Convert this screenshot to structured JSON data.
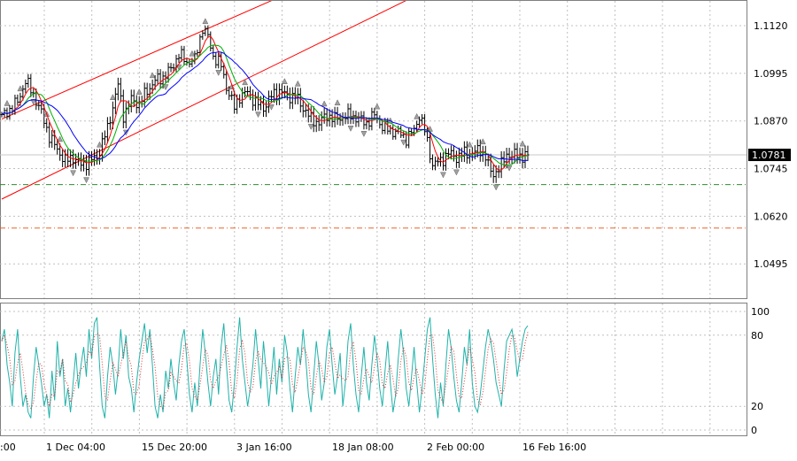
{
  "chart_data": [
    {
      "type": "candlestick",
      "title": "",
      "price_axis_ticks": [
        "1.1120",
        "1.0995",
        "1.0870",
        "1.0745",
        "1.0620",
        "1.0495"
      ],
      "price_axis_values": [
        1.112,
        1.0995,
        1.087,
        1.0745,
        1.062,
        1.0495
      ],
      "ylim": [
        1.0405,
        1.1185
      ],
      "current_price": {
        "label": "1.0781",
        "value": 1.0781,
        "color": "#000000"
      },
      "time_axis_labels": [
        ":00",
        "1 Dec 04:00",
        "15 Dec 20:00",
        "3 Jan 16:00",
        "18 Jan 08:00",
        "2 Feb 00:00",
        "16 Feb 16:00"
      ],
      "horizontal_levels": [
        {
          "value": 1.0703,
          "color": "#2e8b2e",
          "style": "dash-dot"
        },
        {
          "value": 1.0589,
          "color": "#e8622a",
          "style": "dash-dot"
        }
      ],
      "channel": {
        "color": "#ff0000",
        "upper": [
          [
            0,
            1.0875
          ],
          [
            110,
            1.121
          ]
        ],
        "lower": [
          [
            0,
            1.0665
          ],
          [
            160,
            1.121
          ]
        ]
      },
      "bars": 200,
      "close_path": [
        [
          0,
          1.088
        ],
        [
          6,
          1.092
        ],
        [
          9,
          1.0975
        ],
        [
          12,
          1.094
        ],
        [
          15,
          1.089
        ],
        [
          18,
          1.083
        ],
        [
          21,
          1.0795
        ],
        [
          24,
          1.0765
        ],
        [
          27,
          1.0775
        ],
        [
          30,
          1.0755
        ],
        [
          33,
          1.0765
        ],
        [
          36,
          1.0775
        ],
        [
          40,
          1.085
        ],
        [
          44,
          1.0965
        ],
        [
          46,
          1.0885
        ],
        [
          49,
          1.0925
        ],
        [
          52,
          1.0915
        ],
        [
          55,
          1.095
        ],
        [
          58,
          1.0975
        ],
        [
          61,
          1.0985
        ],
        [
          64,
          1.1005
        ],
        [
          67,
          1.1045
        ],
        [
          70,
          1.1025
        ],
        [
          73,
          1.103
        ],
        [
          76,
          1.1115
        ],
        [
          78,
          1.109
        ],
        [
          80,
          1.104
        ],
        [
          83,
          1.1015
        ],
        [
          85,
          1.096
        ],
        [
          88,
          1.0905
        ],
        [
          90,
          1.0935
        ],
        [
          93,
          1.0945
        ],
        [
          96,
          1.092
        ],
        [
          99,
          1.0905
        ],
        [
          102,
          1.0935
        ],
        [
          105,
          1.095
        ],
        [
          108,
          1.0935
        ],
        [
          111,
          1.0935
        ],
        [
          114,
          1.0905
        ],
        [
          117,
          1.0875
        ],
        [
          120,
          1.0865
        ],
        [
          123,
          1.0885
        ],
        [
          126,
          1.0875
        ],
        [
          129,
          1.088
        ],
        [
          132,
          1.0885
        ],
        [
          135,
          1.0875
        ],
        [
          138,
          1.0865
        ],
        [
          141,
          1.0885
        ],
        [
          144,
          1.0855
        ],
        [
          147,
          1.0845
        ],
        [
          150,
          1.084
        ],
        [
          153,
          1.0825
        ],
        [
          156,
          1.0845
        ],
        [
          158,
          1.0885
        ],
        [
          160,
          1.0845
        ],
        [
          163,
          1.0755
        ],
        [
          166,
          1.0765
        ],
        [
          169,
          1.0785
        ],
        [
          172,
          1.0775
        ],
        [
          175,
          1.0785
        ],
        [
          178,
          1.0785
        ],
        [
          181,
          1.0795
        ],
        [
          183,
          1.0775
        ],
        [
          185,
          1.0735
        ],
        [
          187,
          1.0735
        ],
        [
          189,
          1.0755
        ],
        [
          191,
          1.0785
        ],
        [
          193,
          1.0775
        ],
        [
          195,
          1.0785
        ],
        [
          197,
          1.0775
        ],
        [
          199,
          1.0781
        ]
      ],
      "moving_averages": [
        {
          "color": "#ff0000",
          "lag": 2
        },
        {
          "color": "#00b000",
          "lag": 4
        },
        {
          "color": "#0000ff",
          "lag": 8
        }
      ],
      "xlabel": "",
      "ylabel": ""
    },
    {
      "type": "line",
      "title": "",
      "indicator_axis_ticks": [
        "100",
        "80",
        "20",
        "0"
      ],
      "indicator_axis_values": [
        100,
        80,
        20,
        0
      ],
      "levels": [
        80,
        20
      ],
      "ylim": [
        0,
        100
      ],
      "series": [
        {
          "color": "#20b2aa",
          "style": "solid",
          "key": "main",
          "values": [
            75,
            85,
            55,
            40,
            20,
            65,
            85,
            45,
            20,
            30,
            15,
            10,
            45,
            70,
            55,
            40,
            20,
            30,
            10,
            50,
            25,
            75,
            45,
            60,
            20,
            35,
            15,
            40,
            65,
            35,
            55,
            70,
            45,
            85,
            60,
            90,
            95,
            55,
            20,
            10,
            45,
            70,
            55,
            30,
            50,
            85,
            60,
            80,
            45,
            35,
            15,
            40,
            60,
            75,
            90,
            65,
            85,
            55,
            20,
            10,
            30,
            15,
            50,
            35,
            60,
            40,
            25,
            55,
            75,
            85,
            60,
            30,
            15,
            40,
            20,
            55,
            85,
            65,
            40,
            20,
            45,
            60,
            30,
            70,
            90,
            55,
            25,
            15,
            40,
            70,
            95,
            60,
            40,
            20,
            35,
            55,
            85,
            60,
            35,
            75,
            50,
            20,
            45,
            70,
            30,
            60,
            40,
            80,
            65,
            35,
            15,
            45,
            70,
            55,
            85,
            60,
            30,
            15,
            45,
            75,
            55,
            25,
            40,
            70,
            85,
            55,
            30,
            45,
            65,
            20,
            40,
            75,
            90,
            55,
            30,
            15,
            45,
            70,
            40,
            25,
            55,
            80,
            60,
            35,
            20,
            50,
            75,
            40,
            15,
            30,
            60,
            85,
            65,
            35,
            20,
            45,
            70,
            40,
            15,
            35,
            60,
            85,
            95,
            60,
            30,
            10,
            40,
            20,
            55,
            85,
            70,
            45,
            25,
            15,
            40,
            70,
            55,
            85,
            40,
            20,
            15,
            30,
            50,
            70,
            85,
            75,
            60,
            40,
            30,
            20,
            50,
            75,
            80,
            85,
            70,
            45,
            60,
            75,
            85,
            88
          ]
        },
        {
          "color": "#e03030",
          "style": "dotted",
          "key": "signal",
          "lag": 2
        }
      ],
      "xlabel": "",
      "ylabel": ""
    }
  ]
}
